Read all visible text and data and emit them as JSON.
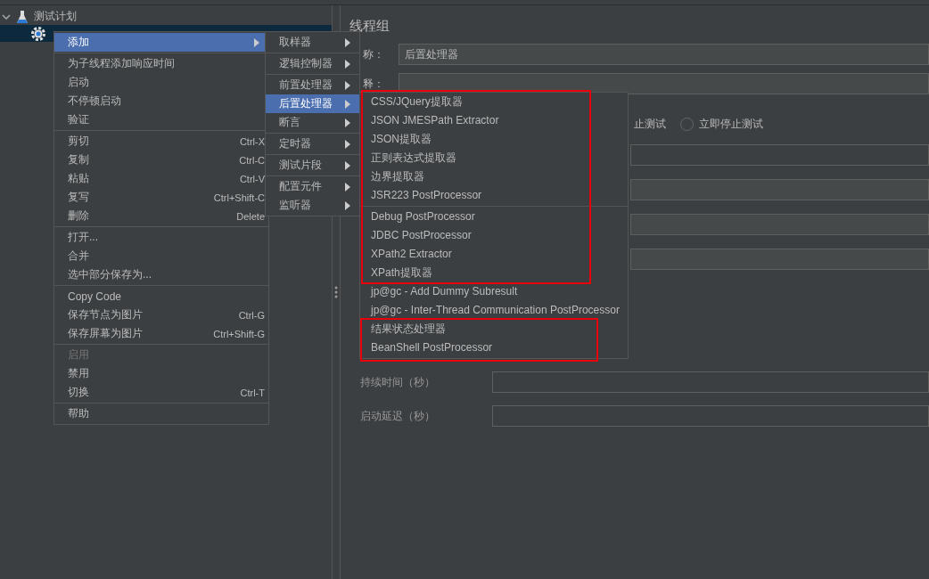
{
  "tree": {
    "items": [
      {
        "label": "测试计划",
        "expanded": true,
        "selected": false
      },
      {
        "selected": true
      }
    ]
  },
  "panel": {
    "title": "线程组",
    "name_label": "称：",
    "name_value": "后置处理器",
    "comment_label": "释：",
    "partial_radio_label": "止测试",
    "radios": [
      {
        "label": "立即停止测试",
        "selected": false
      }
    ],
    "fields": [
      {
        "label": "持续时间（秒）"
      },
      {
        "label": "启动延迟（秒）"
      }
    ]
  },
  "context_menu": {
    "groups": [
      [
        {
          "label": "添加",
          "selected": true,
          "has_submenu": true,
          "disabled": false
        }
      ],
      [
        {
          "label": "为子线程添加响应时间",
          "selected": false,
          "has_submenu": false,
          "disabled": false
        },
        {
          "label": "启动",
          "selected": false,
          "has_submenu": false,
          "disabled": false
        },
        {
          "label": "不停顿启动",
          "selected": false,
          "has_submenu": false,
          "disabled": false
        },
        {
          "label": "验证",
          "selected": false,
          "has_submenu": false,
          "disabled": false
        }
      ],
      [
        {
          "label": "剪切",
          "shortcut": "Ctrl-X",
          "selected": false,
          "has_submenu": false,
          "disabled": false
        },
        {
          "label": "复制",
          "shortcut": "Ctrl-C",
          "selected": false,
          "has_submenu": false,
          "disabled": false
        },
        {
          "label": "粘贴",
          "shortcut": "Ctrl-V",
          "selected": false,
          "has_submenu": false,
          "disabled": false
        },
        {
          "label": "复写",
          "shortcut": "Ctrl+Shift-C",
          "selected": false,
          "has_submenu": false,
          "disabled": false
        },
        {
          "label": "删除",
          "shortcut": "Delete",
          "selected": false,
          "has_submenu": false,
          "disabled": false
        }
      ],
      [
        {
          "label": "打开...",
          "selected": false,
          "has_submenu": false,
          "disabled": false
        },
        {
          "label": "合并",
          "selected": false,
          "has_submenu": false,
          "disabled": false
        },
        {
          "label": "选中部分保存为...",
          "selected": false,
          "has_submenu": false,
          "disabled": false
        }
      ],
      [
        {
          "label": "Copy Code",
          "selected": false,
          "has_submenu": false,
          "disabled": false
        },
        {
          "label": "保存节点为图片",
          "shortcut": "Ctrl-G",
          "selected": false,
          "has_submenu": false,
          "disabled": false
        },
        {
          "label": "保存屏幕为图片",
          "shortcut": "Ctrl+Shift-G",
          "selected": false,
          "has_submenu": false,
          "disabled": false
        }
      ],
      [
        {
          "label": "启用",
          "selected": false,
          "has_submenu": false,
          "disabled": true
        },
        {
          "label": "禁用",
          "selected": false,
          "has_submenu": false,
          "disabled": false
        },
        {
          "label": "切换",
          "shortcut": "Ctrl-T",
          "selected": false,
          "has_submenu": false,
          "disabled": false
        }
      ],
      [
        {
          "label": "帮助",
          "selected": false,
          "has_submenu": false,
          "disabled": false
        }
      ]
    ]
  },
  "add_submenu": {
    "groups": [
      [
        {
          "label": "取样器",
          "selected": false,
          "has_submenu": true
        }
      ],
      [
        {
          "label": "逻辑控制器",
          "selected": false,
          "has_submenu": true
        }
      ],
      [
        {
          "label": "前置处理器",
          "selected": false,
          "has_submenu": true
        },
        {
          "label": "后置处理器",
          "selected": true,
          "has_submenu": true
        },
        {
          "label": "断言",
          "selected": false,
          "has_submenu": true
        }
      ],
      [
        {
          "label": "定时器",
          "selected": false,
          "has_submenu": true
        }
      ],
      [
        {
          "label": "测试片段",
          "selected": false,
          "has_submenu": true
        }
      ],
      [
        {
          "label": "配置元件",
          "selected": false,
          "has_submenu": true
        },
        {
          "label": "监听器",
          "selected": false,
          "has_submenu": true
        }
      ]
    ]
  },
  "postprocessor_submenu": {
    "groups": [
      [
        {
          "label": "CSS/JQuery提取器"
        },
        {
          "label": "JSON JMESPath Extractor"
        },
        {
          "label": "JSON提取器"
        },
        {
          "label": "正则表达式提取器"
        },
        {
          "label": "边界提取器"
        },
        {
          "label": "JSR223 PostProcessor"
        }
      ],
      [
        {
          "label": "Debug PostProcessor"
        },
        {
          "label": "JDBC PostProcessor"
        },
        {
          "label": "XPath2 Extractor"
        },
        {
          "label": "XPath提取器"
        },
        {
          "label": "jp@gc - Add Dummy Subresult"
        },
        {
          "label": "jp@gc - Inter-Thread Communication PostProcessor"
        },
        {
          "label": "结果状态处理器"
        },
        {
          "label": "BeanShell PostProcessor"
        }
      ]
    ]
  }
}
